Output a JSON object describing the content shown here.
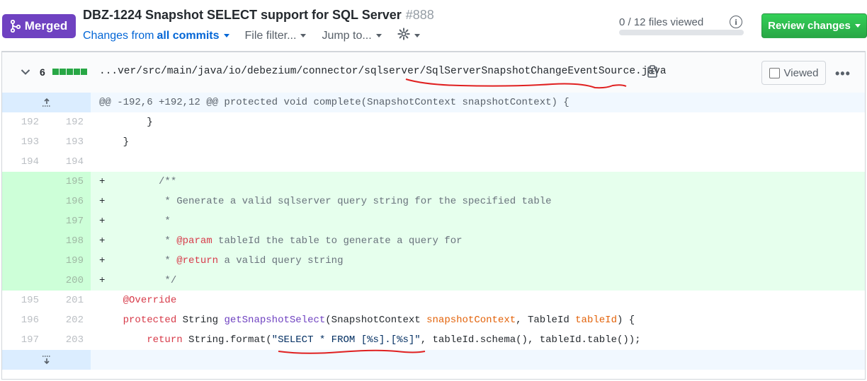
{
  "header": {
    "status_badge": "Merged",
    "title": "DBZ-1224 Snapshot SELECT support for SQL Server",
    "pr_number": "#888",
    "changes_from_label": "Changes from",
    "changes_from_value": "all commits",
    "file_filter": "File filter...",
    "jump_to": "Jump to...",
    "files_viewed": "0 / 12 files viewed",
    "review_button": "Review changes",
    "accent_color": "#6f42c1",
    "review_color": "#28a745"
  },
  "file": {
    "change_count": "6",
    "path_prefix": "...ver/src/main/java/io/debezium/connector/sqlserver/",
    "file_name": "SqlServerSnapshotChangeEventSource.java",
    "viewed_label": "Viewed",
    "more_icon": "kebab-horizontal-icon"
  },
  "diff": {
    "hunk_header": "@@ -192,6 +192,12 @@ protected void complete(SnapshotContext snapshotContext) {",
    "rows": [
      {
        "old": "192",
        "new": "192",
        "sign": "",
        "text": "        }"
      },
      {
        "old": "193",
        "new": "193",
        "sign": "",
        "text": "    }"
      },
      {
        "old": "194",
        "new": "194",
        "sign": "",
        "text": ""
      },
      {
        "old": "",
        "new": "195",
        "sign": "+",
        "text": "    /**"
      },
      {
        "old": "",
        "new": "196",
        "sign": "+",
        "text": "     * Generate a valid sqlserver query string for the specified table"
      },
      {
        "old": "",
        "new": "197",
        "sign": "+",
        "text": "     *"
      },
      {
        "old": "",
        "new": "198",
        "sign": "+",
        "text_a": "     * ",
        "tag": "@param",
        "text_b": " tableId the table to generate a query for"
      },
      {
        "old": "",
        "new": "199",
        "sign": "+",
        "text_a": "     * ",
        "tag": "@return",
        "text_b": " a valid query string"
      },
      {
        "old": "",
        "new": "200",
        "sign": "+",
        "text": "     */"
      },
      {
        "old": "195",
        "new": "201",
        "sign": "",
        "annotation": "@Override"
      },
      {
        "old": "196",
        "new": "202",
        "sign": "",
        "kw": "protected",
        "type": " String ",
        "fn": "getSnapshotSelect",
        "p1": "(SnapshotContext ",
        "v1": "snapshotContext",
        "p2": ", TableId ",
        "v2": "tableId",
        "p3": ") {"
      },
      {
        "old": "197",
        "new": "203",
        "sign": "",
        "kw": "return",
        "t1": " String.format(",
        "str": "\"SELECT * FROM [%s].[%s]\"",
        "t2": ", tableId.schema(), tableId.table());"
      }
    ]
  }
}
